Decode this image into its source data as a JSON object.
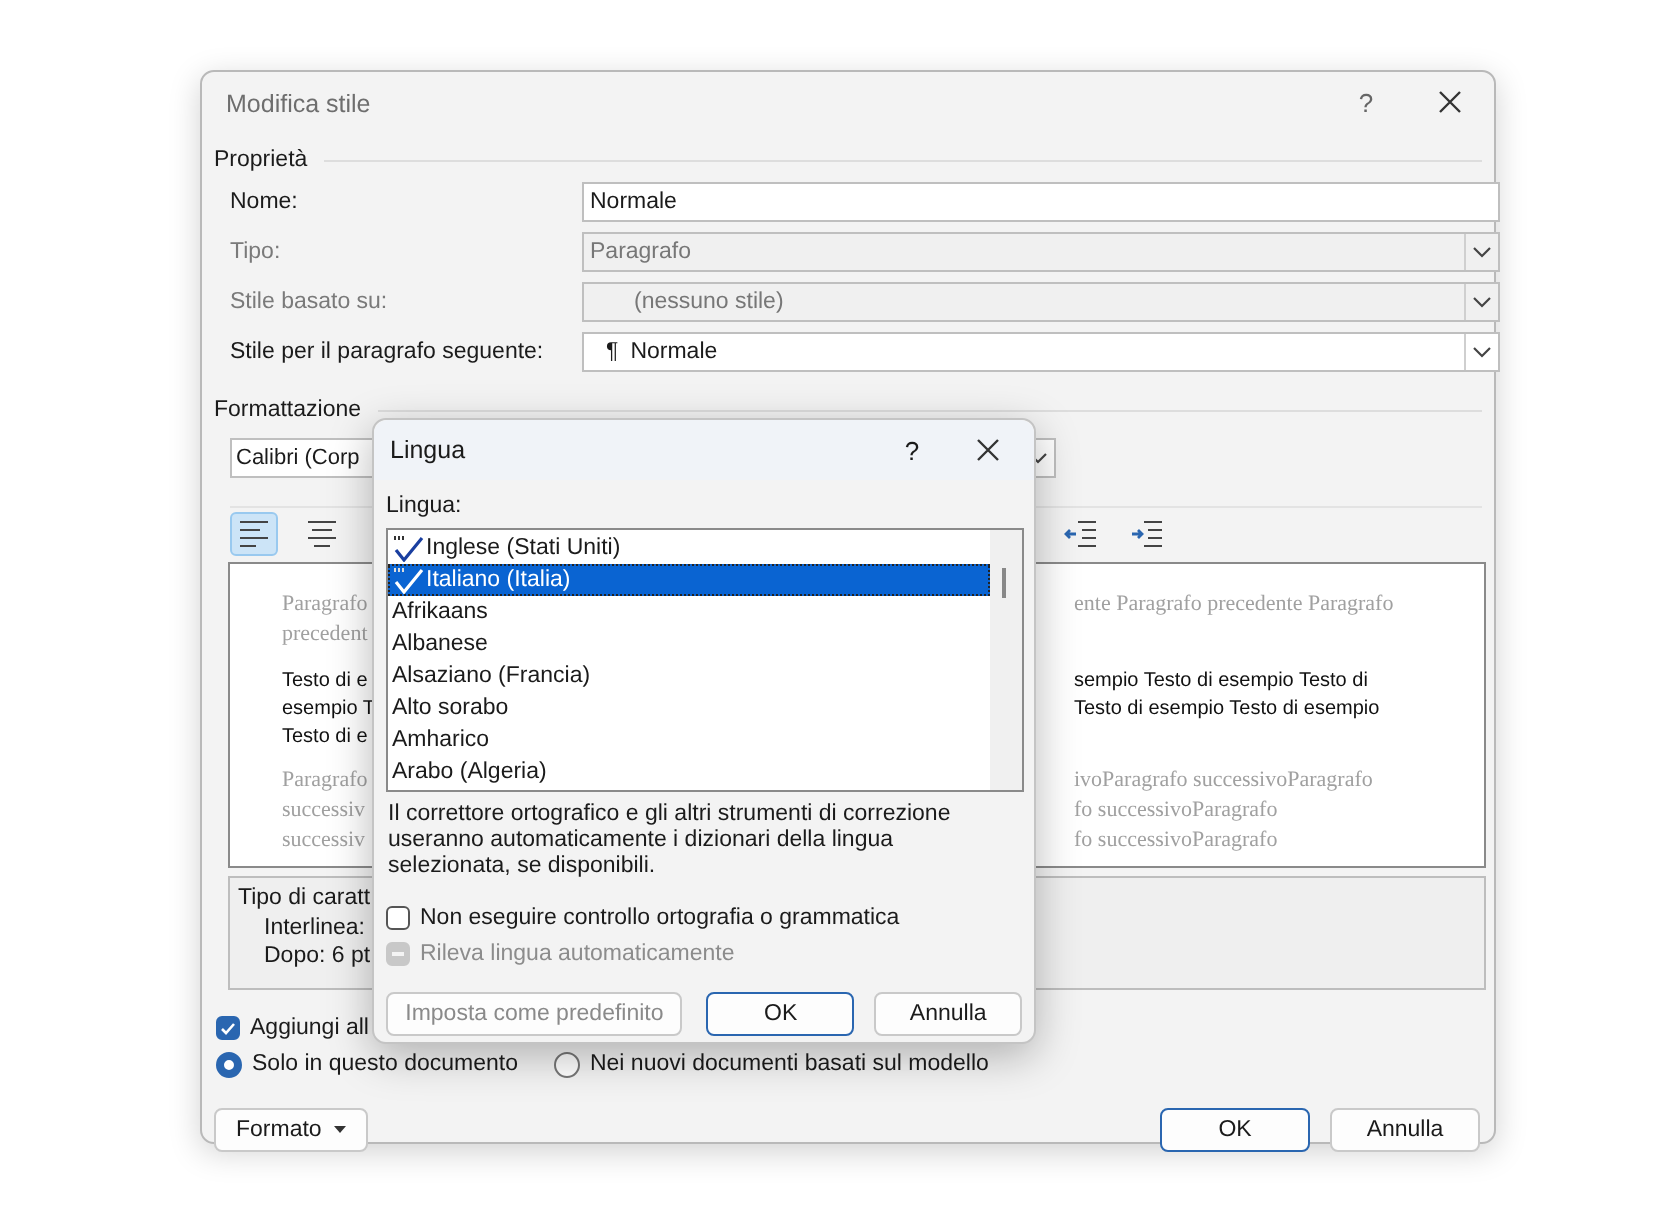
{
  "main_dialog": {
    "title": "Modifica stile",
    "help": "?",
    "properties": {
      "heading": "Proprietà",
      "fields": [
        {
          "label": "Nome:",
          "value": "Normale",
          "kind": "text",
          "disabled": false
        },
        {
          "label": "Tipo:",
          "value": "Paragrafo",
          "kind": "dropdown",
          "disabled": true
        },
        {
          "label": "Stile basato su:",
          "value": "(nessuno stile)",
          "kind": "dropdown",
          "disabled": true
        },
        {
          "label": "Stile per il paragrafo seguente:",
          "value": "Normale",
          "mark": "¶",
          "kind": "dropdown",
          "disabled": false
        }
      ]
    },
    "formatting": {
      "heading": "Formattazione",
      "font": "Calibri (Corp",
      "toolbar_left": [
        {
          "kind": "align-left",
          "selected": true
        },
        {
          "kind": "align-center",
          "selected": false
        }
      ],
      "toolbar_right": [
        {
          "kind": "outdent",
          "selected": false
        },
        {
          "kind": "indent",
          "selected": false
        }
      ]
    },
    "preview": {
      "left": {
        "previous": [
          "Paragrafo",
          "precedent"
        ],
        "sample": [
          "Testo di e",
          "esempio T",
          "Testo di e"
        ],
        "next": [
          "Paragrafo",
          "successiv",
          "successiv"
        ]
      },
      "right": {
        "previous": [
          "ente Paragrafo precedente Paragrafo"
        ],
        "sample": [
          "sempio Testo di esempio Testo di",
          "Testo di esempio Testo di esempio"
        ],
        "next": [
          "ivoParagrafo successivoParagrafo",
          "fo successivoParagrafo",
          "fo successivoParagrafo"
        ]
      }
    },
    "description": [
      "Tipo di caratt",
      "Interlinea:",
      "Dopo:  6 pt"
    ],
    "add_to_gallery": {
      "label": "Aggiungi all",
      "checked": true
    },
    "scope": [
      {
        "label": "Solo in questo documento",
        "selected": true
      },
      {
        "label": "Nei nuovi documenti basati sul modello",
        "selected": false
      }
    ],
    "format_button": "Formato",
    "buttons": [
      {
        "label": "OK",
        "kind": "default"
      },
      {
        "label": "Annulla",
        "kind": "secondary"
      }
    ]
  },
  "language_dialog": {
    "title": "Lingua",
    "help": "?",
    "list_label": "Lingua:",
    "languages": [
      {
        "name": "Inglese (Stati Uniti)",
        "proofing": true,
        "selected": false
      },
      {
        "name": "Italiano (Italia)",
        "proofing": true,
        "selected": true
      },
      {
        "name": "Afrikaans",
        "proofing": false,
        "selected": false
      },
      {
        "name": "Albanese",
        "proofing": false,
        "selected": false
      },
      {
        "name": "Alsaziano (Francia)",
        "proofing": false,
        "selected": false
      },
      {
        "name": "Alto sorabo",
        "proofing": false,
        "selected": false
      },
      {
        "name": "Amharico",
        "proofing": false,
        "selected": false
      },
      {
        "name": "Arabo (Algeria)",
        "proofing": false,
        "selected": false
      }
    ],
    "note": "Il correttore ortografico e gli altri strumenti di correzione useranno automaticamente i dizionari della lingua selezionata, se disponibili.",
    "options": [
      {
        "label": "Non eseguire controllo ortografia o grammatica",
        "checked": false,
        "disabled": false
      },
      {
        "label": "Rileva lingua automaticamente",
        "indeterminate": true,
        "disabled": true
      }
    ],
    "buttons": [
      {
        "label": "Imposta come predefinito",
        "kind": "secondary"
      },
      {
        "label": "OK",
        "kind": "default"
      },
      {
        "label": "Annulla",
        "kind": "secondary"
      }
    ]
  }
}
